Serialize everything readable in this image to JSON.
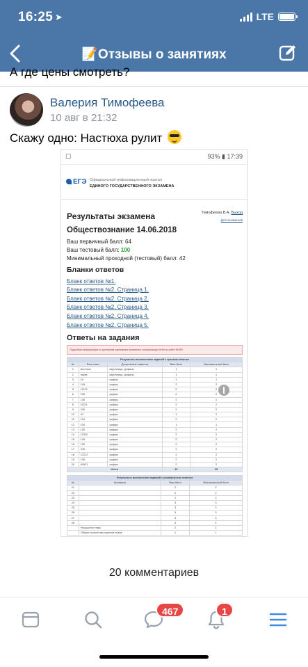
{
  "status_bar": {
    "time": "16:25",
    "network": "LTE"
  },
  "nav": {
    "title": "📝Отзывы о занятиях"
  },
  "feed": {
    "previous_comment_text": "А где цены смотреть?",
    "comment": {
      "author": "Валерия Тимофеева",
      "date": "10 авг в 21:32",
      "text": "Скажу одно: Настюха рулит"
    }
  },
  "attachment": {
    "status": {
      "left": "☐",
      "right": "93% ▮ 17:39"
    },
    "site": {
      "logo": "ЕГЭ",
      "subtitle_1": "Официальный информационный портал",
      "subtitle_2": "ЕДИНОГО ГОСУДАРСТВЕННОГО ЭКЗАМЕНА"
    },
    "results_title": "Результаты экзамена",
    "user_name": "Тимофеева В.А.",
    "exit_link": "Выход",
    "exit_link_2": "Для экзаменов",
    "subject_line": "Обществознание 14.06.2018",
    "primary_score_label": "Ваш первичный балл: ",
    "primary_score": "64",
    "test_score_label": "Ваш тестовый балл: ",
    "test_score": "100",
    "min_score_label": "Минимальный проходной (тестовый) балл: ",
    "min_score": "42",
    "blanks_heading": "Бланки ответов",
    "blank_links": [
      "Бланк ответов №1.",
      "Бланк ответов №2. Страница 1.",
      "Бланк ответов №2. Страница 2.",
      "Бланк ответов №2. Страница 3.",
      "Бланк ответов №2. Страница 4.",
      "Бланк ответов №2. Страница 5."
    ],
    "answers_heading": "Ответы на задания",
    "notice_text": "Подробную информацию по критериям оценивания экзамена в спецификации КИМ на сайте ФИПИ",
    "table1": {
      "caption": "Результаты выполнения заданий с кратким ответом",
      "headers": [
        "№",
        "Ваш ответ",
        "Допустимые символы",
        "Ваш балл",
        "Максимальный балл"
      ],
      "rows": [
        [
          "1",
          "местные",
          "кириллица, дефисы",
          "1",
          "1"
        ],
        [
          "2",
          "наука",
          "кириллица, дефисы",
          "1",
          "1"
        ],
        [
          "3",
          "16",
          "цифры",
          "1",
          "1"
        ],
        [
          "4",
          "145",
          "цифры",
          "2",
          "2"
        ],
        [
          "5",
          "11122",
          "цифры",
          "2",
          "2"
        ],
        [
          "6",
          "245",
          "цифры",
          "2",
          "2"
        ],
        [
          "7",
          "135",
          "цифры",
          "2",
          "2"
        ],
        [
          "8",
          "22211",
          "цифры",
          "2",
          "2"
        ],
        [
          "9",
          "245",
          "цифры",
          "2",
          "2"
        ],
        [
          "10",
          "34",
          "цифры",
          "1",
          "1"
        ],
        [
          "11",
          "124",
          "цифры",
          "2",
          "2"
        ],
        [
          "12",
          "234",
          "цифры",
          "1",
          "1"
        ],
        [
          "13",
          "125",
          "цифры",
          "2",
          "2"
        ],
        [
          "14",
          "12332",
          "цифры",
          "2",
          "2"
        ],
        [
          "15",
          "145",
          "цифры",
          "2",
          "2"
        ],
        [
          "16",
          "125",
          "цифры",
          "2",
          "2"
        ],
        [
          "17",
          "245",
          "цифры",
          "2",
          "2"
        ],
        [
          "18",
          "12212",
          "цифры",
          "2",
          "2"
        ],
        [
          "19",
          "135",
          "цифры",
          "2",
          "2"
        ],
        [
          "20",
          "64921",
          "цифры",
          "2",
          "2"
        ]
      ],
      "total_label": "Итого",
      "total_yours": "35",
      "total_max": "35"
    },
    "table2": {
      "caption": "Результаты выполнения заданий с развёрнутым ответом",
      "headers": [
        "№",
        "Критерии",
        "Ваш балл",
        "Максимальный балл"
      ],
      "rows": [
        [
          "21",
          "",
          "2",
          "2"
        ],
        [
          "22",
          "",
          "2",
          "2"
        ],
        [
          "23",
          "",
          "2",
          "2"
        ],
        [
          "24",
          "",
          "3",
          "3"
        ],
        [
          "25",
          "",
          "3",
          "3"
        ],
        [
          "26",
          "",
          "3",
          "3"
        ],
        [
          "27",
          "",
          "3",
          "3"
        ],
        [
          "28",
          "",
          "4",
          "4"
        ],
        [
          "",
          "Раскрытие темы",
          "2",
          "2"
        ],
        [
          "",
          "Общее количество пунктов плана",
          "1",
          "1"
        ]
      ]
    }
  },
  "comments_count_text": "20 комментариев",
  "tabbar": {
    "messages_badge": "467",
    "notifications_badge": "1"
  },
  "colors": {
    "brand": "#4a76a8",
    "link": "#2a5885",
    "badge": "#e64646",
    "icon": "#3f8ae0"
  }
}
